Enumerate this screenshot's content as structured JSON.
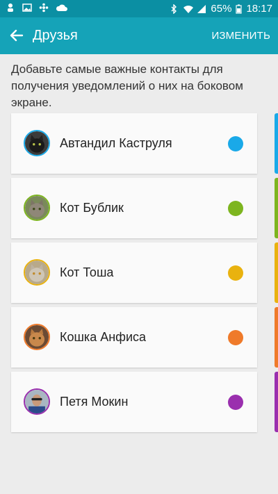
{
  "status": {
    "battery": "65%",
    "time": "18:17",
    "left_icons": [
      "person-icon",
      "image-icon",
      "flower-icon",
      "cloud-icon"
    ],
    "right_icons": [
      "bluetooth-icon",
      "wifi-icon",
      "signal-icon",
      "battery-icon"
    ]
  },
  "appbar": {
    "title": "Друзья",
    "edit_label": "ИЗМЕНИТЬ"
  },
  "description": "Добавьте самые важные контакты для получения уведомлений о них на боковом экране.",
  "contacts": [
    {
      "name": "Автандил Каструля",
      "color": "#1aa9e8"
    },
    {
      "name": "Кот Бублик",
      "color": "#7db51f"
    },
    {
      "name": "Кот Тоша",
      "color": "#e9b20f"
    },
    {
      "name": "Кошка Анфиса",
      "color": "#ef7a2a"
    },
    {
      "name": "Петя Мокин",
      "color": "#9a2fae"
    }
  ],
  "accent": "#15a3b8"
}
